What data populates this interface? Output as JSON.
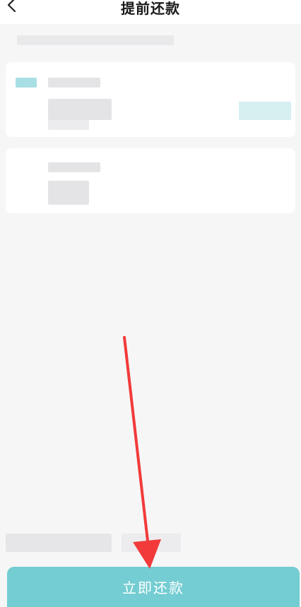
{
  "header": {
    "title": "提前还款",
    "back_icon": "chevron-left-icon"
  },
  "action": {
    "pay_button_label": "立即还款"
  },
  "colors": {
    "accent": "#74cdd2",
    "annotation_arrow": "#f23a3a"
  }
}
